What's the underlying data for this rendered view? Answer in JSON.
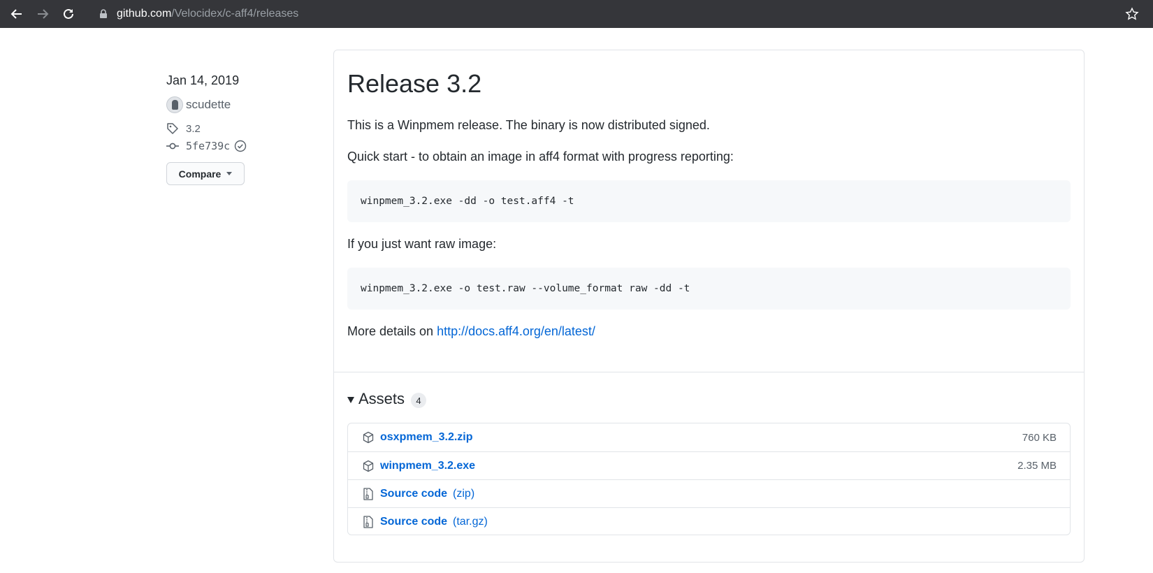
{
  "browser": {
    "url_domain": "github.com",
    "url_path": "/Velocidex/c-aff4/releases"
  },
  "sidebar": {
    "date": "Jan 14, 2019",
    "author": "scudette",
    "tag": "3.2",
    "commit": "5fe739c",
    "compare_label": "Compare"
  },
  "release": {
    "title": "Release 3.2",
    "intro": "This is a Winpmem release. The binary is now distributed signed.",
    "quick_start": "Quick start - to obtain an image in aff4 format with progress reporting:",
    "code_aff4": "winpmem_3.2.exe -dd -o test.aff4 -t",
    "raw_intro": "If you just want raw image:",
    "code_raw": "winpmem_3.2.exe -o test.raw --volume_format raw -dd -t",
    "details_prefix": "More details on ",
    "details_link": "http://docs.aff4.org/en/latest/"
  },
  "assets": {
    "label": "Assets",
    "count": "4",
    "items": [
      {
        "name": "osxpmem_3.2.zip",
        "ext": "",
        "size": "760 KB",
        "icon": "package-icon"
      },
      {
        "name": "winpmem_3.2.exe",
        "ext": "",
        "size": "2.35 MB",
        "icon": "package-icon"
      },
      {
        "name": "Source code",
        "ext": "(zip)",
        "size": "",
        "icon": "file-zip-icon"
      },
      {
        "name": "Source code",
        "ext": "(tar.gz)",
        "size": "",
        "icon": "file-zip-icon"
      }
    ]
  }
}
